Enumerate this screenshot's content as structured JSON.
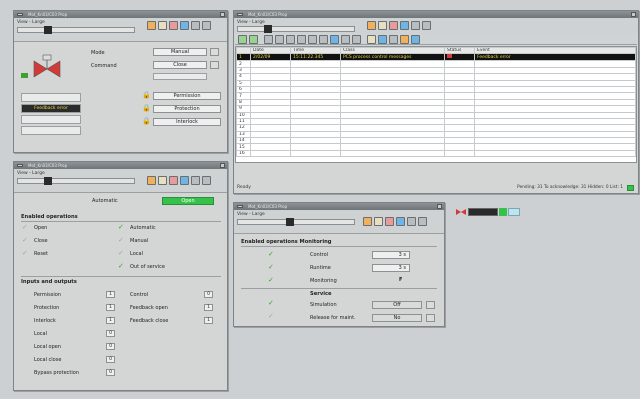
{
  "faceplate": {
    "title": "Mot_Kn03/C03 Prop",
    "view_label": "View - Large",
    "mode_label": "Mode",
    "mode_value": "Manual",
    "command_label": "Command",
    "command_value": "Close",
    "feedback_text": "Feedback error",
    "permission_btn": "Permission",
    "protection_btn": "Protection",
    "interlock_btn": "Interlock"
  },
  "ops": {
    "title": "Mot_Kn03/C03 Prop",
    "view_label": "View - Large",
    "automatic_label": "Automatic",
    "open_btn": "Open",
    "enabled_header": "Enabled operations",
    "left_items": [
      "Open",
      "Close",
      "Reset"
    ],
    "right_items": [
      "Automatic",
      "Manual",
      "Local",
      "Out of service"
    ],
    "io_header": "Inputs and outputs",
    "io_left": [
      {
        "label": "Permission",
        "value": "1"
      },
      {
        "label": "Protection",
        "value": "1"
      },
      {
        "label": "Interlock",
        "value": "1"
      },
      {
        "label": "Local",
        "value": "0"
      },
      {
        "label": "Local open",
        "value": "0"
      },
      {
        "label": "Local close",
        "value": "0"
      },
      {
        "label": "Bypass protection",
        "value": "0"
      }
    ],
    "io_right": [
      {
        "label": "Control",
        "value": "0"
      },
      {
        "label": "Feedback open",
        "value": "1"
      },
      {
        "label": "Feedback close",
        "value": "1"
      }
    ]
  },
  "alarm": {
    "title": "Mot_Kn03/C03 Prop",
    "view_label": "View - Large",
    "columns": [
      "",
      "Date",
      "Time",
      "Class",
      "Status",
      "Event"
    ],
    "rows": [
      [
        "1",
        "2/02/09",
        "15:11:22.345",
        "PCS process control messages",
        "",
        "Feedback error"
      ],
      [
        "2",
        "",
        "",
        "",
        "",
        ""
      ],
      [
        "3",
        "",
        "",
        "",
        "",
        ""
      ],
      [
        "4",
        "",
        "",
        "",
        "",
        ""
      ],
      [
        "5",
        "",
        "",
        "",
        "",
        ""
      ],
      [
        "6",
        "",
        "",
        "",
        "",
        ""
      ],
      [
        "7",
        "",
        "",
        "",
        "",
        ""
      ],
      [
        "8",
        "",
        "",
        "",
        "",
        ""
      ],
      [
        "9",
        "",
        "",
        "",
        "",
        ""
      ],
      [
        "10",
        "",
        "",
        "",
        "",
        ""
      ],
      [
        "11",
        "",
        "",
        "",
        "",
        ""
      ],
      [
        "12",
        "",
        "",
        "",
        "",
        ""
      ],
      [
        "13",
        "",
        "",
        "",
        "",
        ""
      ],
      [
        "14",
        "",
        "",
        "",
        "",
        ""
      ],
      [
        "15",
        "",
        "",
        "",
        "",
        ""
      ],
      [
        "16",
        "",
        "",
        "",
        "",
        ""
      ]
    ],
    "status_left": "Ready",
    "status_right": "Pending: 31   To acknowledge: 31   Hidden: 0   List: 1"
  },
  "monitor": {
    "title": "Mot_Kn03/C03 Prop",
    "view_label": "View - Large",
    "header": "Enabled operations Monitoring",
    "items": [
      {
        "label": "Control",
        "value": "3 s"
      },
      {
        "label": "Runtime",
        "value": "3 s"
      },
      {
        "label": "Monitoring",
        "value": "F"
      }
    ],
    "service_header": "Service",
    "simulation_label": "Simulation",
    "simulation_value": "Off",
    "release_label": "Release for maint.",
    "release_value": "No"
  },
  "colors": {
    "accent_green": "#35c24a",
    "alarm_text": "#e8d94a",
    "valve_red": "#d23a3a"
  }
}
